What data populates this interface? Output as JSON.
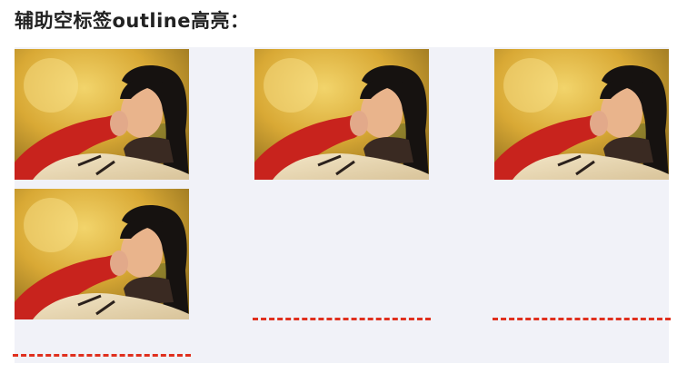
{
  "heading": "辅助空标签outline高亮：",
  "gallery": {
    "photo_count": 4,
    "photo_alt": "photo",
    "outline_color": "#e0301e",
    "panel_color": "#f1f2f8"
  }
}
